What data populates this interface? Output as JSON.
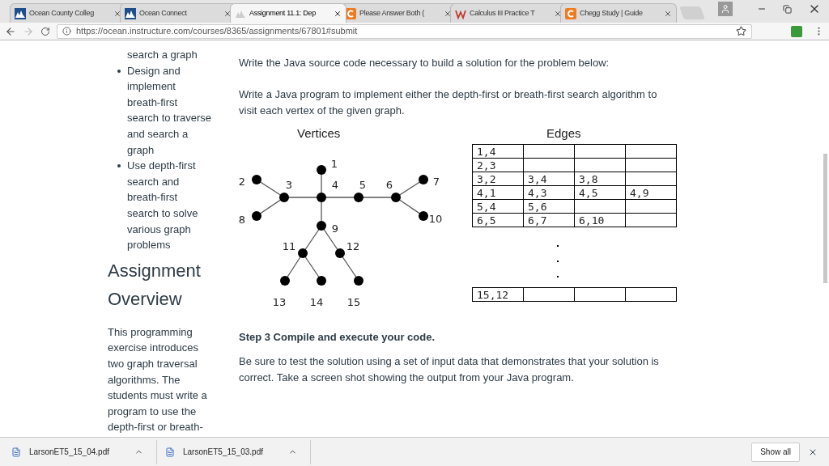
{
  "browser": {
    "tabs": [
      {
        "title": "Ocean County Colleg",
        "selected": false
      },
      {
        "title": "Ocean Connect",
        "selected": false
      },
      {
        "title": "Assignment 11.1: Dep",
        "selected": true
      },
      {
        "title": "Please Answer Both (",
        "selected": false
      },
      {
        "title": "Calculus III Practice T",
        "selected": false
      },
      {
        "title": "Chegg Study | Guide",
        "selected": false
      }
    ],
    "url": "https://ocean.instructure.com/courses/8365/assignments/67801#submit"
  },
  "sidebar": {
    "lead_line": "search a graph",
    "bullets": [
      {
        "lines": [
          "Design and",
          "implement",
          "breath-first",
          "search to traverse",
          "and search a",
          "graph"
        ]
      },
      {
        "lines": [
          "Use depth-first",
          "search and",
          "breath-first",
          "search to solve",
          "various graph",
          "problems"
        ]
      }
    ],
    "heading": [
      "Assignment",
      "Overview"
    ],
    "paragraph": [
      "This programming",
      "exercise introduces",
      "two graph traversal",
      "algorithms. The",
      "students must write a",
      "program to use the",
      "depth-first or breath-"
    ]
  },
  "content": {
    "intro": "Write the Java source code necessary to build a solution for the problem below:",
    "task": "Write a Java program to implement either the depth-first or breath-first search algorithm to visit each vertex of the given graph.",
    "vertices_title": "Vertices",
    "vertices": [
      "1",
      "2",
      "3",
      "4",
      "5",
      "6",
      "7",
      "8",
      "9",
      "10",
      "11",
      "12",
      "13",
      "14",
      "15"
    ],
    "edges_title": "Edges",
    "edges_rows": [
      [
        "1,4"
      ],
      [
        "2,3"
      ],
      [
        "3,2",
        "3,4",
        "3,8"
      ],
      [
        "4,1",
        "4,3",
        "4,5",
        "4,9"
      ],
      [
        "5,4",
        "5,6"
      ],
      [
        "6,5",
        "6,7",
        "6,10"
      ]
    ],
    "edges_last_row": [
      "15,12"
    ],
    "step_title": "Step 3 Compile and execute your code.",
    "step_text": "Be sure to test the solution using a set of input data that demonstrates that your solution is correct. Take a screen shot showing the output from your Java program."
  },
  "downloads": {
    "files": [
      "LarsonET5_15_04.pdf",
      "LarsonET5_15_03.pdf"
    ],
    "show_all": "Show all"
  }
}
